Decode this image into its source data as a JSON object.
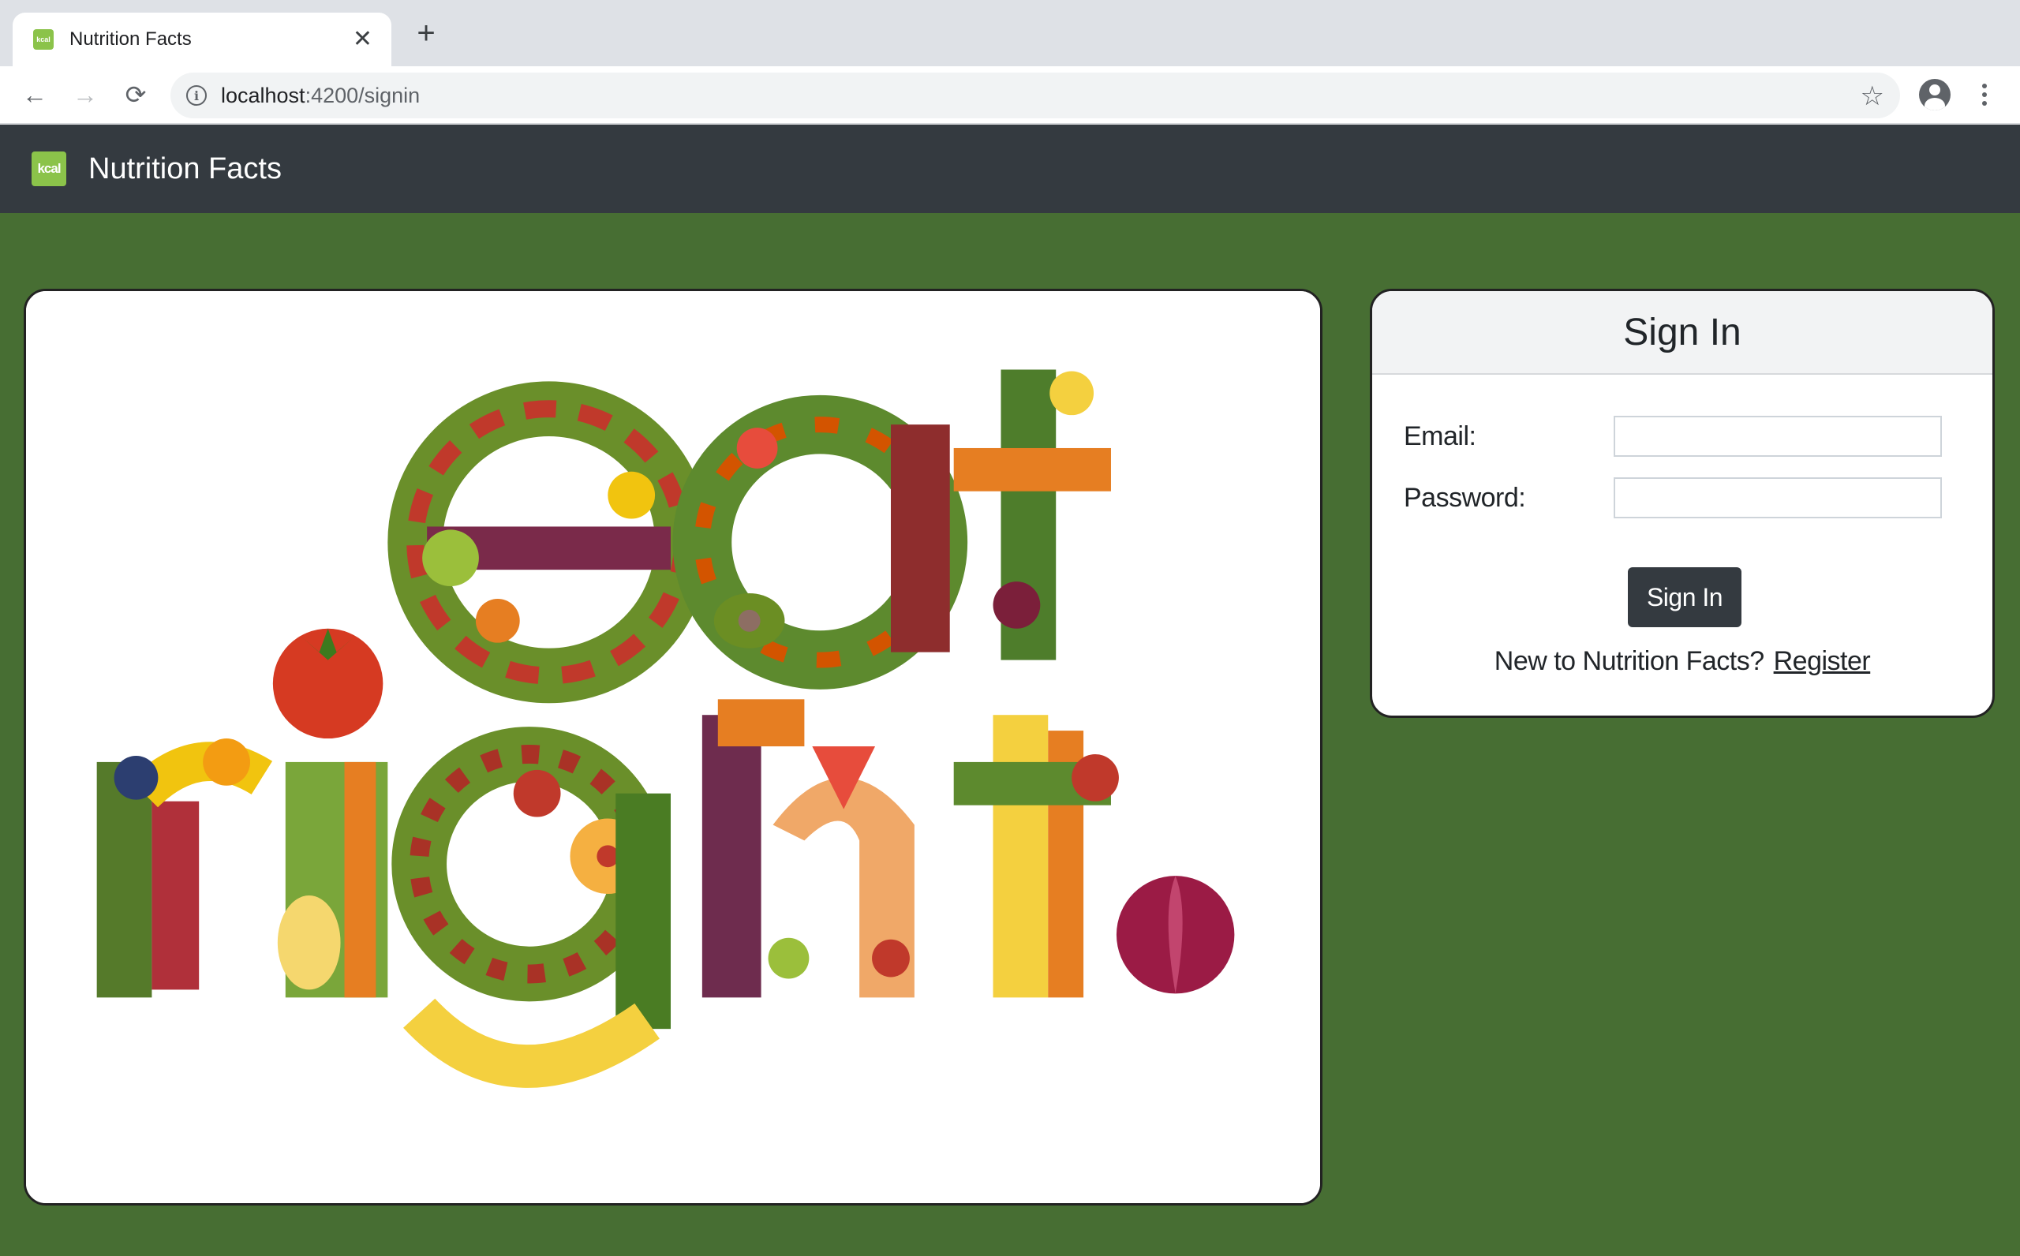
{
  "browser": {
    "tab": {
      "title": "Nutrition Facts",
      "favicon_icon": "kcal-logo-icon",
      "favicon_text": "kcal"
    },
    "url": {
      "host": "localhost",
      "path": ":4200/signin"
    }
  },
  "navbar": {
    "brand_logo_text": "kcal",
    "brand_name": "Nutrition Facts",
    "background": "#343a40",
    "logo_color": "#8bc34a"
  },
  "hero": {
    "image": "eat-right-vegetables-image"
  },
  "signin": {
    "title": "Sign In",
    "email_label": "Email:",
    "email_value": "",
    "password_label": "Password:",
    "password_value": "",
    "submit_label": "Sign In",
    "register_prompt": "New to Nutrition Facts?",
    "register_link": "Register",
    "button_color": "#343a40"
  },
  "page": {
    "background": "#476e33"
  }
}
